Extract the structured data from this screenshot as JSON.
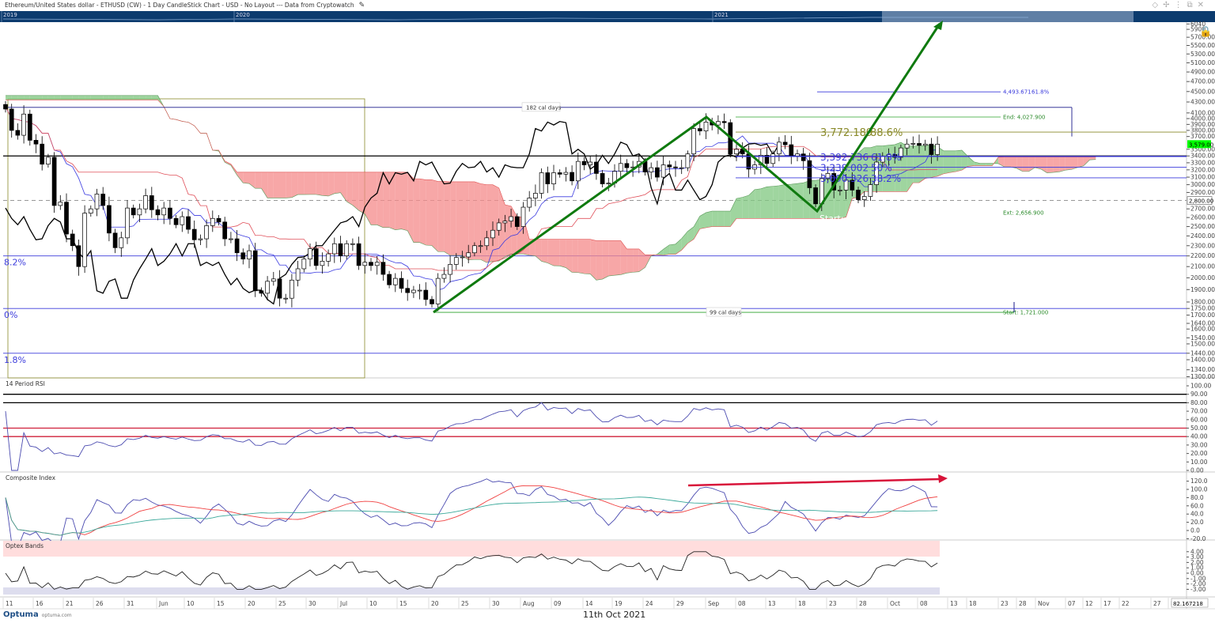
{
  "header": {
    "title": "Ethereum/United States dollar - ETHUSD (CW) - 1 Day CandleStick Chart - USD - No Layout --- Data from Cryptowatch",
    "edit_icon": "pencil-icon",
    "window_icons": [
      "diamond-icon",
      "pin-icon",
      "more-icon",
      "restore-icon",
      "close-icon"
    ],
    "overview_years": [
      "2019",
      "2020",
      "2021"
    ]
  },
  "colors": {
    "up": "#ffffff",
    "down": "#000000",
    "cloud_bull": "#7fc77f",
    "cloud_bear": "#f48a8a",
    "tenkan": "#3a3ae0",
    "kijun": "#e0505a",
    "chikou": "#000000",
    "fib": "#3b3bdc",
    "path": "#0f7a0f",
    "olive": "#8a8a2a",
    "arrow": "#d8143a",
    "last_price_bg": "#00ff00"
  },
  "chart_data": {
    "type": "candlestick",
    "title": "ETHUSD 1 Day",
    "start_date": "2021-05-11",
    "closes": [
      4170,
      3800,
      3720,
      4080,
      3640,
      3580,
      3280,
      3380,
      2740,
      2780,
      2420,
      2300,
      2100,
      2650,
      2700,
      2880,
      2740,
      2430,
      2280,
      2380,
      2710,
      2630,
      2700,
      2860,
      2690,
      2630,
      2710,
      2590,
      2520,
      2610,
      2470,
      2360,
      2370,
      2510,
      2590,
      2550,
      2370,
      2370,
      2230,
      2170,
      2250,
      1890,
      1870,
      1970,
      1990,
      1830,
      1830,
      1980,
      2080,
      2170,
      2270,
      2110,
      2150,
      2220,
      2320,
      2200,
      2320,
      2320,
      2110,
      2140,
      2110,
      2140,
      2030,
      1940,
      1995,
      1910,
      1875,
      1895,
      1895,
      1820,
      1785,
      1995,
      2030,
      2120,
      2185,
      2190,
      2230,
      2300,
      2300,
      2380,
      2460,
      2540,
      2560,
      2610,
      2500,
      2720,
      2830,
      2890,
      3160,
      3010,
      3160,
      3140,
      3165,
      3050,
      3320,
      3270,
      3310,
      3150,
      3010,
      3020,
      3180,
      3290,
      3230,
      3240,
      3320,
      3170,
      3230,
      3100,
      3270,
      3240,
      3230,
      3230,
      3430,
      3830,
      3790,
      3940,
      3890,
      3950,
      3930,
      3430,
      3500,
      3430,
      3210,
      3270,
      3410,
      3290,
      3430,
      3610,
      3570,
      3400,
      3430,
      3330,
      2960,
      2760,
      3080,
      3150,
      2930,
      2930,
      3060,
      2930,
      2810,
      2850,
      3000,
      3310,
      3390,
      3420,
      3380,
      3520,
      3580,
      3590,
      3560,
      3580,
      3420,
      3579
    ],
    "price_axis": {
      "scale": "log",
      "ticks": [
        "6040",
        "5900",
        "5700.00",
        "5500.00",
        "5300.00",
        "5100.00",
        "4900.00",
        "4700.00",
        "4500.00",
        "4300.00",
        "4100.00",
        "4000.00",
        "3900.00",
        "3800.00",
        "3700.00",
        "3500.00",
        "3400.00",
        "3300.00",
        "3200.00",
        "3100.00",
        "3000.00",
        "2900.00",
        "2700.00",
        "2600.00",
        "2500.00",
        "2400.00",
        "2300.00",
        "2200.00",
        "2100.00",
        "2000.00",
        "1900.00",
        "1800.00",
        "1750.00",
        "1700.00",
        "1640.00",
        "1600.00",
        "1540.00",
        "1500.00",
        "1440.00",
        "1400.00",
        "1340.00",
        "1300.00"
      ]
    },
    "last_price": "3,579.00",
    "marker_price": "2,800.00",
    "x_labels": [
      "11",
      "16",
      "21",
      "26",
      "31",
      "Jun",
      "10",
      "15",
      "20",
      "25",
      "30",
      "Jul",
      "10",
      "15",
      "20",
      "25",
      "30",
      "Aug",
      "09",
      "14",
      "19",
      "24",
      "29",
      "Sep",
      "08",
      "13",
      "18",
      "23",
      "28",
      "Oct",
      "08",
      "13",
      "18",
      "23",
      "28",
      "Nov",
      "07",
      "12",
      "17",
      "22",
      "27",
      "D"
    ],
    "crosshair_readout": "82.167218",
    "annotations": {
      "span_top": {
        "label": "182 cal days",
        "price": 4200
      },
      "span_bottom": {
        "label": "99 cal days"
      },
      "fib_ext": {
        "label": "4,493.671",
        "pct": "61.8%",
        "price": 4493.671
      },
      "end": {
        "label": "End: 4,027.900",
        "price": 4027.9
      },
      "start": {
        "label": "Start: 1,721.000",
        "price": 1721
      },
      "ext": {
        "label": "Ext: 2,656.900",
        "price": 2656.9
      },
      "start_tag": "Start:",
      "retrace": [
        {
          "value": "3,772.189",
          "pct": "88.6%",
          "price": 3772.189
        },
        {
          "value": "3,392.736",
          "pct": "61.8%",
          "price": 3392.736
        },
        {
          "value": "3,238.002",
          "pct": "50%",
          "price": 3238.002
        },
        {
          "value": "3,090.326",
          "pct": "38.2%",
          "price": 3090.326
        }
      ],
      "left_fibs": [
        {
          "label": "8.2%",
          "price": 2200
        },
        {
          "label": "0%",
          "price": 1750
        },
        {
          "label": "1.8%",
          "price": 1440
        }
      ],
      "horizontal_black": 3400,
      "dashed": 2800
    },
    "panels": [
      {
        "title": "14 Period RSI",
        "ticks": [
          "100.00",
          "90.00",
          "80.00",
          "70.00",
          "60.00",
          "50.00",
          "40.00",
          "30.00",
          "20.00",
          "10.00",
          "0.00"
        ],
        "levels": [
          90,
          80,
          50,
          40
        ]
      },
      {
        "title": "Composite Index",
        "ticks": [
          "120.0",
          "100.0",
          "80.0",
          "60.0",
          "40.0",
          "20.0",
          "0.0",
          "-20.0"
        ]
      },
      {
        "title": "Optex Bands",
        "ticks": [
          "4.00",
          "3.00",
          "2.00",
          "1.00",
          "0.00",
          "-1.00",
          "-2.00",
          "-3.00"
        ]
      }
    ]
  },
  "footer": {
    "brand": "Optuma",
    "site": "optuma.com",
    "date": "11th Oct 2021"
  }
}
